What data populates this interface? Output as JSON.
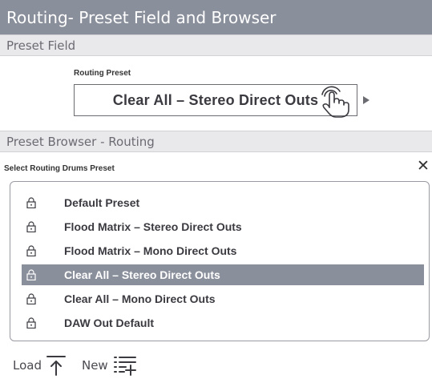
{
  "title": "Routing- Preset Field and Browser",
  "preset_field_section": {
    "header": "Preset Field",
    "label": "Routing Preset",
    "value": "Clear All – Stereo Direct Outs"
  },
  "preset_browser_section": {
    "header": "Preset Browser - Routing",
    "label": "Select Routing Drums Preset",
    "close": "✕",
    "items": [
      {
        "label": "Default Preset",
        "selected": false
      },
      {
        "label": "Flood Matrix – Stereo Direct Outs",
        "selected": false
      },
      {
        "label": "Flood Matrix – Mono Direct Outs",
        "selected": false
      },
      {
        "label": "Clear All – Stereo Direct Outs",
        "selected": true
      },
      {
        "label": "Clear All – Mono Direct Outs",
        "selected": false
      },
      {
        "label": "DAW Out Default",
        "selected": false
      }
    ]
  },
  "footer": {
    "load_label": "Load",
    "new_label": "New"
  },
  "colors": {
    "title_bar": "#8a8f9c",
    "section_bar": "#e9e9ec",
    "selected_row": "#8a8f9c"
  },
  "icons": {
    "lock": "lock-icon",
    "hand": "hand-pointer-icon",
    "load": "upload-arrow-icon",
    "new": "new-list-icon",
    "close": "close-icon"
  }
}
